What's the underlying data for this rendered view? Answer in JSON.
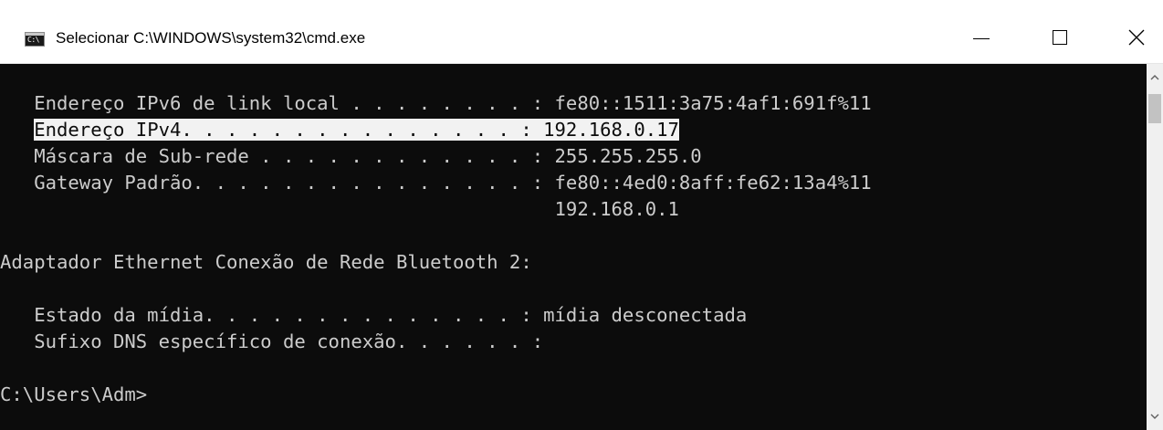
{
  "window": {
    "title": "Selecionar C:\\WINDOWS\\system32\\cmd.exe",
    "icon_name": "cmd-icon",
    "icon_text": "C:\\"
  },
  "controls": {
    "minimize_icon": "minimize-icon",
    "maximize_icon": "maximize-icon",
    "close_icon": "close-icon"
  },
  "console": {
    "lines": [
      "   Endereço IPv6 de link local . . . . . . . . : fe80::1511:3a75:4af1:691f%11",
      "   Endereço IPv4. . . . . . . . . . . . . . . : 192.168.0.17",
      "   Máscara de Sub-rede . . . . . . . . . . . . : 255.255.255.0",
      "   Gateway Padrão. . . . . . . . . . . . . . . : fe80::4ed0:8aff:fe62:13a4%11",
      "                                                 192.168.0.1",
      "",
      "Adaptador Ethernet Conexão de Rede Bluetooth 2:",
      "",
      "   Estado da mídia. . . . . . . . . . . . . . : mídia desconectada",
      "   Sufixo DNS específico de conexão. . . . . . :",
      "",
      "C:\\Users\\Adm>"
    ],
    "selection": {
      "line_index": 1,
      "text_prefix": "   ",
      "selected_text": "Endereço IPv4. . . . . . . . . . . . . . . : 192.168.0.17"
    }
  },
  "colors": {
    "console_bg": "#0c0c0c",
    "console_fg": "#cccccc",
    "selection_bg": "#f2f2f2",
    "titlebar_bg": "#ffffff"
  },
  "scrollbar": {
    "up_icon": "scroll-up-arrow-icon",
    "down_icon": "scroll-down-arrow-icon"
  }
}
